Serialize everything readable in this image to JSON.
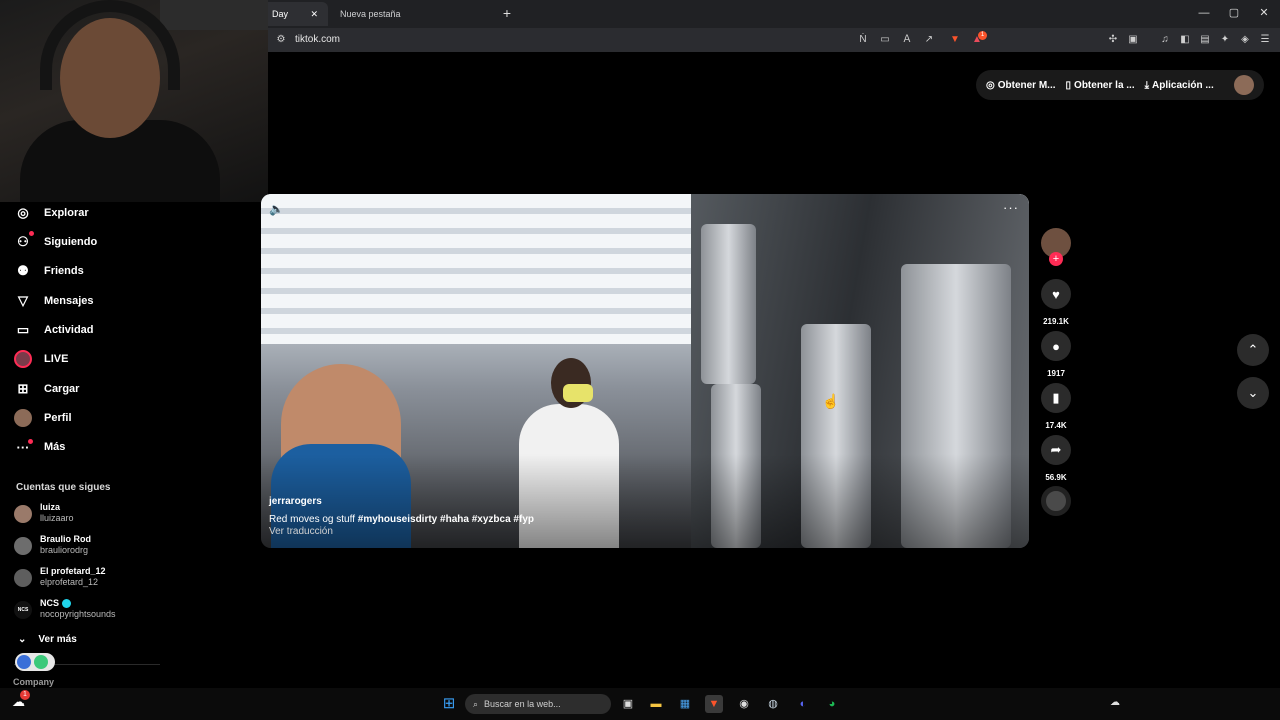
{
  "browser": {
    "tabs": [
      {
        "label": "Day",
        "close": "✕"
      },
      {
        "label": "Nueva pestaña"
      }
    ],
    "new_tab": "+",
    "url": "tiktok.com",
    "window_controls": {
      "minimize": "—",
      "restore": "▢",
      "close": "✕"
    },
    "extension_badge": "1"
  },
  "header": {
    "actions": [
      "Obtener M...",
      "Obtener la ...",
      "Aplicación ..."
    ]
  },
  "sidebar": {
    "items": [
      {
        "icon": "compass-icon",
        "glyph": "◎",
        "label": "Explorar"
      },
      {
        "icon": "following-icon",
        "glyph": "⚇",
        "label": "Siguiendo"
      },
      {
        "icon": "friends-icon",
        "glyph": "⚉",
        "label": "Friends"
      },
      {
        "icon": "messages-icon",
        "glyph": "▽",
        "label": "Mensajes"
      },
      {
        "icon": "activity-icon",
        "glyph": "▭",
        "label": "Actividad"
      },
      {
        "icon": "live-icon",
        "glyph": "",
        "label": "LIVE"
      },
      {
        "icon": "upload-icon",
        "glyph": "⊞",
        "label": "Cargar"
      },
      {
        "icon": "profile-icon",
        "glyph": "",
        "label": "Perfil"
      },
      {
        "icon": "more-icon",
        "glyph": "···",
        "label": "Más"
      }
    ],
    "following_title": "Cuentas que sigues",
    "accounts": [
      {
        "name": "luiza",
        "handle": "lluizaaro"
      },
      {
        "name": "Braulio Rod",
        "handle": "brauliorodrg"
      },
      {
        "name": "El profetard_12",
        "handle": "elprofetard_12"
      },
      {
        "name": "NCS",
        "handle": "nocopyrightsounds",
        "avatar_text": "NCS"
      }
    ],
    "see_more": "Ver más",
    "chevron": "⌄",
    "company": "Company"
  },
  "video": {
    "username": "jerrarogers",
    "caption_text": "Red moves og stuff",
    "hashtags": [
      "#myhouseisdirty",
      "#haha",
      "#xyzbca",
      "#fyp"
    ],
    "translate": "Ver traducción",
    "volume_glyph": "🔈",
    "more_glyph": "···"
  },
  "actions": {
    "follow_glyph": "+",
    "like": {
      "glyph": "♥",
      "count": "219.1K"
    },
    "comment": {
      "glyph": "●",
      "count": "1917"
    },
    "save": {
      "glyph": "▮",
      "count": "17.4K"
    },
    "share": {
      "glyph": "➦",
      "count": "56.9K"
    }
  },
  "nav_arrows": {
    "up": "⌃",
    "down": "⌄"
  },
  "taskbar": {
    "search_placeholder": "Buscar en la web...",
    "search_glyph": "⌕",
    "notification_badge": "1"
  },
  "colors": {
    "accent": "#fe2c55",
    "background": "#000000",
    "chrome": "#202124"
  }
}
